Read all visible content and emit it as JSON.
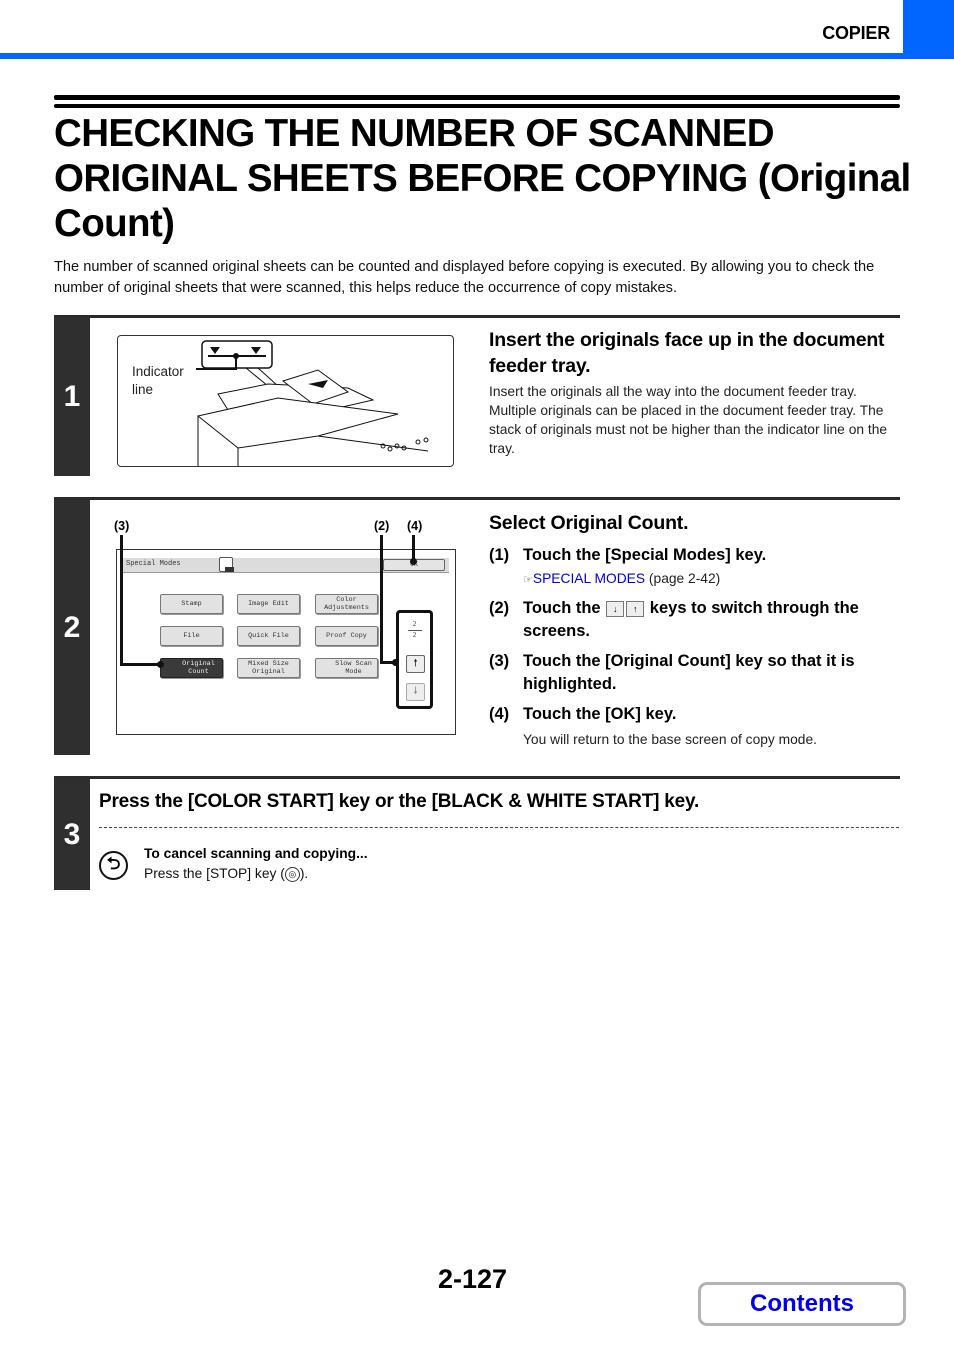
{
  "header": {
    "section_label": "COPIER",
    "accent_color": "#0066ff"
  },
  "title": "CHECKING THE NUMBER OF SCANNED ORIGINAL SHEETS BEFORE COPYING (Original Count)",
  "intro": "The number of scanned original sheets can be counted and displayed before copying is executed. By allowing you to check the number of original sheets that were scanned, this helps reduce the occurrence of copy mistakes.",
  "steps": [
    {
      "number": "1",
      "heading": "Insert the originals face up in the document feeder tray.",
      "body": "Insert the originals all the way into the document feeder tray. Multiple originals can be placed in the document feeder tray. The stack of originals must not be higher than the indicator line on the tray.",
      "figure": {
        "indicator_label": "Indicator line"
      }
    },
    {
      "number": "2",
      "heading": "Select Original Count.",
      "figure": {
        "callouts": [
          "(3)",
          "(2)",
          "(4)"
        ],
        "panel_title": "Special Modes",
        "ok_label": "OK",
        "buttons": [
          "Stamp",
          "Image Edit",
          "Color Adjustments",
          "File",
          "Quick File",
          "Proof Copy",
          "Original Count",
          "Mixed Size Original",
          "Slow Scan Mode"
        ],
        "selected_button": "Original Count",
        "page_current": "2",
        "page_total": "2"
      },
      "substeps": [
        {
          "num": "(1)",
          "text": "Touch the [Special Modes] key.",
          "ref_link": "SPECIAL MODES",
          "ref_page": "(page 2-42)"
        },
        {
          "num": "(2)",
          "text_before": "Touch the",
          "text_after": "keys to switch through the screens."
        },
        {
          "num": "(3)",
          "text": "Touch the [Original Count] key so that it is highlighted."
        },
        {
          "num": "(4)",
          "text": "Touch the [OK] key.",
          "note": "You will return to the base screen of copy mode."
        }
      ]
    },
    {
      "number": "3",
      "heading": "Press the [COLOR START] key or the [BLACK & WHITE START] key.",
      "note_title": "To cancel scanning and copying...",
      "note_body_before": "Press the [STOP] key (",
      "note_body_after": ")."
    }
  ],
  "footer": {
    "page_number": "2-127",
    "contents_label": "Contents",
    "contents_color": "#0000ee"
  }
}
